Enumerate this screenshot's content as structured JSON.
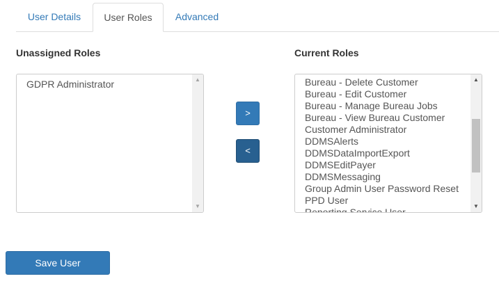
{
  "tabs": [
    {
      "label": "User Details",
      "active": false
    },
    {
      "label": "User Roles",
      "active": true
    },
    {
      "label": "Advanced",
      "active": false
    }
  ],
  "unassigned": {
    "heading": "Unassigned Roles",
    "items": [
      "GDPR Administrator"
    ]
  },
  "current": {
    "heading": "Current Roles",
    "items": [
      "Bureau - Delete Customer",
      "Bureau - Edit Customer",
      "Bureau - Manage Bureau Jobs",
      "Bureau - View Bureau Customer",
      "Customer Administrator",
      "DDMSAlerts",
      "DDMSDataImportExport",
      "DDMSEditPayer",
      "DDMSMessaging",
      "Group Admin User Password Reset",
      "PPD User",
      "Reporting Service User"
    ]
  },
  "buttons": {
    "assign_label": ">",
    "unassign_label": "<",
    "save_label": "Save User"
  },
  "icons": {
    "scroll_up": "triangle-up-icon",
    "scroll_down": "triangle-down-icon"
  },
  "colors": {
    "primary": "#337ab7",
    "primary_active": "#286090",
    "tab_link": "#337ab7",
    "border": "#dddddd"
  }
}
